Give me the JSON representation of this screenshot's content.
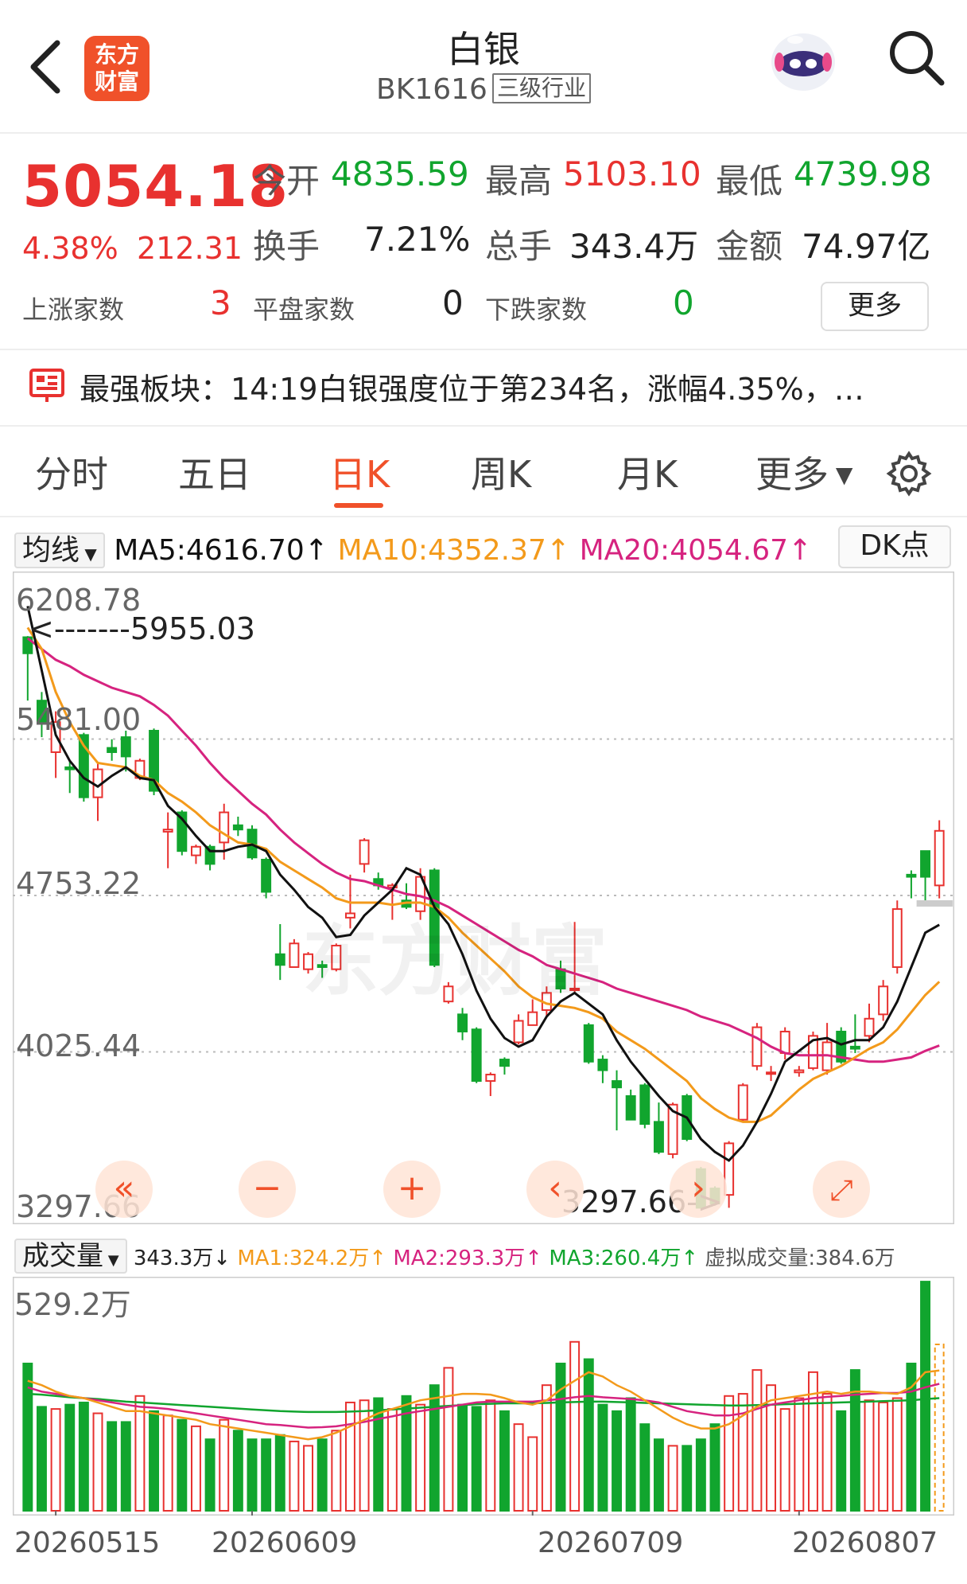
{
  "header": {
    "logo_line1": "东方",
    "logo_line2": "财富",
    "title": "白银",
    "code": "BK1616",
    "level_tag": "三级行业"
  },
  "quote": {
    "price": "5054.18",
    "change_pct": "4.38%",
    "change_amt": "212.31",
    "open_label": "今开",
    "open_value": "4835.59",
    "high_label": "最高",
    "high_value": "5103.10",
    "low_label": "最低",
    "low_value": "4739.98",
    "turnover_label": "换手",
    "turnover_value": "7.21%",
    "volume_label": "总手",
    "volume_value": "343.4万",
    "amount_label": "金额",
    "amount_value": "74.97亿",
    "up_label": "上涨家数",
    "up_value": "3",
    "flat_label": "平盘家数",
    "flat_value": "0",
    "down_label": "下跌家数",
    "down_value": "0",
    "more_label": "更多"
  },
  "sector": {
    "label": "最强板块：",
    "text": "14:19白银强度位于第234名，涨幅4.35%，…"
  },
  "tabs": [
    "分时",
    "五日",
    "日K",
    "周K",
    "月K",
    "更多"
  ],
  "ma": {
    "selector": "均线",
    "ma5": "MA5:4616.70↑",
    "ma10": "MA10:4352.37↑",
    "ma20": "MA20:4054.67↑",
    "dk": "DK点"
  },
  "kchart_labels": {
    "y_top": "6208.78",
    "y2": "5481.00",
    "y3": "4753.22",
    "y4": "4025.44",
    "y_bottom": "3297.66",
    "max_mark": "<-------5955.03",
    "min_mark": "3297.66->",
    "watermark": "东方财富"
  },
  "volume": {
    "selector": "成交量",
    "vol": "343.3万↓",
    "ma1": "MA1:324.2万↑",
    "ma2": "MA2:293.3万↑",
    "ma3": "MA3:260.4万↑",
    "virtual": "虚拟成交量:384.6万",
    "y_top": "529.2万"
  },
  "dates": [
    "20260515",
    "20260609",
    "20260709",
    "20260807"
  ],
  "colors": {
    "up": "#e8312f",
    "down": "#11a52e",
    "accent": "#f0512a",
    "ma5": "#111111",
    "ma10": "#f39a1b",
    "ma20": "#d6237f"
  },
  "chart_data": {
    "type": "candlestick",
    "ylim": [
      3297.66,
      6208.78
    ],
    "ticks": [
      6208.78,
      5481.0,
      4753.22,
      4025.44,
      3297.66
    ],
    "candles": [
      [
        5955,
        5880,
        5960,
        5660
      ],
      [
        5660,
        5560,
        5700,
        5490
      ],
      [
        5420,
        5560,
        5610,
        5300
      ],
      [
        5350,
        5340,
        5380,
        5230
      ],
      [
        5500,
        5210,
        5510,
        5190
      ],
      [
        5210,
        5340,
        5370,
        5100
      ],
      [
        5440,
        5420,
        5480,
        5380
      ],
      [
        5490,
        5400,
        5520,
        5330
      ],
      [
        5300,
        5380,
        5390,
        5290
      ],
      [
        5520,
        5240,
        5530,
        5220
      ],
      [
        5050,
        5060,
        5140,
        4880
      ],
      [
        5140,
        4960,
        5150,
        4940
      ],
      [
        4940,
        4980,
        4990,
        4900
      ],
      [
        4980,
        4900,
        4990,
        4870
      ],
      [
        5000,
        5140,
        5180,
        4920
      ],
      [
        5080,
        5060,
        5120,
        5030
      ],
      [
        5060,
        4930,
        5080,
        4920
      ],
      [
        4920,
        4770,
        4930,
        4740
      ],
      [
        4480,
        4430,
        4620,
        4360
      ],
      [
        4420,
        4530,
        4550,
        4420
      ],
      [
        4410,
        4480,
        4490,
        4390
      ],
      [
        4430,
        4420,
        4450,
        4370
      ],
      [
        4410,
        4520,
        4530,
        4400
      ],
      [
        4650,
        4670,
        4850,
        4600
      ],
      [
        4900,
        5010,
        5020,
        4860
      ],
      [
        4830,
        4800,
        4860,
        4780
      ],
      [
        4790,
        4800,
        4810,
        4640
      ],
      [
        4730,
        4700,
        4810,
        4690
      ],
      [
        4680,
        4840,
        4880,
        4640
      ],
      [
        4870,
        4430,
        4880,
        4420
      ],
      [
        4260,
        4330,
        4350,
        4250
      ],
      [
        4200,
        4120,
        4230,
        4080
      ],
      [
        4130,
        3890,
        4140,
        3880
      ],
      [
        3890,
        3920,
        3930,
        3820
      ],
      [
        3990,
        3960,
        4000,
        3920
      ],
      [
        4070,
        4170,
        4200,
        4060
      ],
      [
        4150,
        4210,
        4270,
        4150
      ],
      [
        4220,
        4300,
        4330,
        4190
      ],
      [
        4410,
        4320,
        4450,
        4300
      ],
      [
        4320,
        4320,
        4630,
        4300
      ],
      [
        4150,
        3980,
        4160,
        3970
      ],
      [
        3990,
        3940,
        4010,
        3880
      ],
      [
        3890,
        3860,
        3940,
        3660
      ],
      [
        3820,
        3710,
        3850,
        3720
      ],
      [
        3870,
        3690,
        3880,
        3670
      ],
      [
        3700,
        3560,
        3790,
        3550
      ],
      [
        3550,
        3780,
        3790,
        3530
      ],
      [
        3820,
        3620,
        3830,
        3610
      ],
      [
        3480,
        3300,
        3490,
        3298
      ],
      [
        3390,
        3320,
        3400,
        3310
      ],
      [
        3360,
        3600,
        3610,
        3300
      ],
      [
        3710,
        3870,
        3880,
        3700
      ],
      [
        3960,
        4140,
        4160,
        3940
      ],
      [
        3930,
        3930,
        3960,
        3890
      ],
      [
        4020,
        4120,
        4140,
        3990
      ],
      [
        3930,
        3940,
        3960,
        3910
      ],
      [
        3950,
        4100,
        4120,
        3940
      ],
      [
        3940,
        4070,
        4160,
        3920
      ],
      [
        4120,
        3980,
        4140,
        3970
      ],
      [
        4050,
        4040,
        4200,
        4020
      ],
      [
        4100,
        4180,
        4250,
        4070
      ],
      [
        4200,
        4330,
        4360,
        4170
      ],
      [
        4420,
        4690,
        4730,
        4390
      ],
      [
        4850,
        4840,
        4870,
        4740
      ],
      [
        4960,
        4840,
        4960,
        4730
      ],
      [
        4800,
        5054,
        5103,
        4740
      ]
    ],
    "ma5": [
      6100,
      5800,
      5500,
      5380,
      5300,
      5260,
      5310,
      5350,
      5300,
      5290,
      5170,
      5110,
      5030,
      4960,
      4960,
      4980,
      4990,
      4960,
      4850,
      4780,
      4700,
      4650,
      4560,
      4570,
      4660,
      4720,
      4780,
      4880,
      4850,
      4700,
      4620,
      4480,
      4310,
      4180,
      4090,
      4050,
      4080,
      4190,
      4260,
      4300,
      4250,
      4200,
      4080,
      3980,
      3900,
      3820,
      3750,
      3720,
      3620,
      3560,
      3520,
      3590,
      3700,
      3830,
      3980,
      4030,
      4080,
      4090,
      4060,
      4080,
      4080,
      4140,
      4260,
      4420,
      4580,
      4617
    ],
    "ma10": [
      6000,
      5900,
      5700,
      5560,
      5450,
      5370,
      5360,
      5350,
      5310,
      5290,
      5230,
      5190,
      5140,
      5080,
      5040,
      5000,
      4990,
      4970,
      4910,
      4870,
      4830,
      4790,
      4740,
      4720,
      4720,
      4720,
      4710,
      4720,
      4720,
      4700,
      4650,
      4580,
      4520,
      4460,
      4400,
      4330,
      4280,
      4250,
      4240,
      4230,
      4210,
      4180,
      4120,
      4080,
      4040,
      3990,
      3940,
      3890,
      3810,
      3760,
      3720,
      3700,
      3700,
      3730,
      3790,
      3850,
      3900,
      3930,
      3960,
      4000,
      4040,
      4070,
      4130,
      4210,
      4290,
      4352
    ],
    "ma20": [
      5950,
      5900,
      5850,
      5820,
      5780,
      5750,
      5720,
      5700,
      5680,
      5640,
      5590,
      5520,
      5450,
      5370,
      5300,
      5240,
      5180,
      5130,
      5060,
      5000,
      4950,
      4900,
      4860,
      4830,
      4820,
      4800,
      4780,
      4760,
      4750,
      4730,
      4700,
      4660,
      4620,
      4580,
      4540,
      4500,
      4470,
      4430,
      4410,
      4390,
      4370,
      4350,
      4320,
      4300,
      4280,
      4260,
      4240,
      4220,
      4190,
      4170,
      4150,
      4120,
      4090,
      4050,
      4020,
      4010,
      4010,
      4010,
      4000,
      3990,
      3980,
      3980,
      3990,
      4000,
      4030,
      4055
    ],
    "volume": {
      "ylim": [
        0,
        529.2
      ],
      "values": [
        340,
        240,
        235,
        245,
        250,
        225,
        205,
        205,
        265,
        230,
        220,
        210,
        195,
        165,
        210,
        185,
        165,
        165,
        175,
        160,
        150,
        165,
        185,
        250,
        255,
        260,
        235,
        265,
        245,
        290,
        330,
        245,
        240,
        255,
        230,
        200,
        170,
        290,
        340,
        390,
        350,
        245,
        230,
        260,
        200,
        165,
        150,
        150,
        165,
        200,
        265,
        270,
        325,
        290,
        235,
        260,
        320,
        270,
        230,
        325,
        255,
        250,
        260,
        340,
        529,
        384
      ],
      "ma1": [
        300,
        290,
        275,
        265,
        260,
        250,
        240,
        230,
        230,
        225,
        220,
        215,
        210,
        200,
        195,
        190,
        185,
        180,
        175,
        170,
        165,
        170,
        180,
        195,
        210,
        225,
        235,
        245,
        255,
        260,
        265,
        270,
        270,
        268,
        260,
        250,
        245,
        255,
        280,
        300,
        320,
        310,
        290,
        275,
        255,
        235,
        215,
        200,
        190,
        190,
        200,
        220,
        240,
        255,
        260,
        265,
        270,
        275,
        270,
        275,
        275,
        272,
        270,
        285,
        320,
        324
      ],
      "ma2": [
        285,
        275,
        270,
        265,
        260,
        255,
        250,
        245,
        240,
        238,
        235,
        230,
        225,
        220,
        215,
        210,
        205,
        200,
        198,
        195,
        192,
        193,
        195,
        200,
        205,
        212,
        218,
        225,
        230,
        235,
        240,
        245,
        250,
        252,
        252,
        252,
        252,
        255,
        258,
        262,
        265,
        262,
        260,
        258,
        255,
        250,
        240,
        230,
        225,
        220,
        220,
        225,
        235,
        245,
        250,
        255,
        260,
        263,
        265,
        268,
        270,
        272,
        272,
        275,
        285,
        293
      ],
      "ma3": [
        270,
        268,
        265,
        262,
        260,
        258,
        255,
        252,
        250,
        248,
        246,
        244,
        242,
        240,
        238,
        236,
        234,
        232,
        230,
        229,
        228,
        228,
        228,
        229,
        230,
        232,
        234,
        236,
        238,
        240,
        242,
        244,
        246,
        247,
        248,
        248,
        248,
        249,
        250,
        251,
        252,
        252,
        251,
        250,
        249,
        248,
        247,
        246,
        245,
        244,
        243,
        243,
        244,
        245,
        246,
        247,
        248,
        249,
        250,
        251,
        252,
        253,
        254,
        255,
        258,
        260
      ]
    }
  }
}
